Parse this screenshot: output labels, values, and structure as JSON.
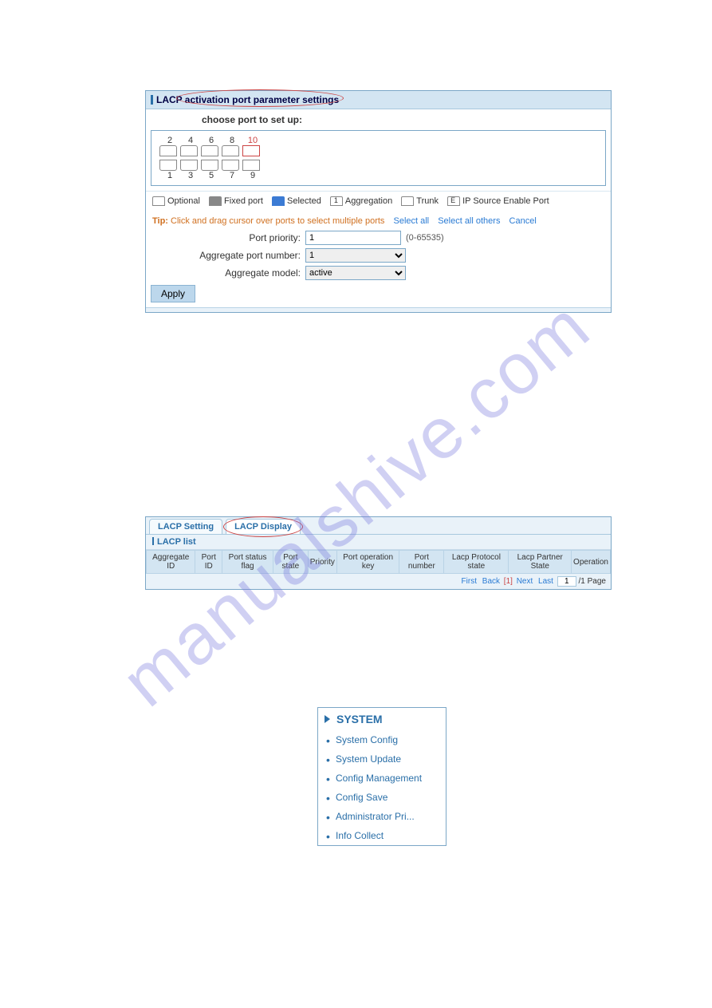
{
  "watermark": "manualshive.com",
  "panel1": {
    "title": "LACP activation port parameter settings",
    "choose_label": "choose port to set up:",
    "ports_top_nums": [
      "2",
      "4",
      "6",
      "8",
      "10"
    ],
    "ports_bottom_nums": [
      "1",
      "3",
      "5",
      "7",
      "9"
    ],
    "selected_port": "10",
    "legend": {
      "optional": "Optional",
      "fixed": "Fixed port",
      "selected": "Selected",
      "aggregation": "Aggregation",
      "trunk": "Trunk",
      "ipsrc": "IP Source Enable Port"
    },
    "tip_label": "Tip:",
    "tip_text": "Click and drag cursor over ports to select multiple ports",
    "link_select_all": "Select all",
    "link_select_others": "Select all others",
    "link_cancel": "Cancel",
    "form": {
      "port_priority_label": "Port priority:",
      "port_priority_value": "1",
      "port_priority_hint": "(0-65535)",
      "agg_port_num_label": "Aggregate port number:",
      "agg_port_num_value": "1",
      "agg_model_label": "Aggregate model:",
      "agg_model_value": "active"
    },
    "apply_label": "Apply"
  },
  "panel2": {
    "tab_setting": "LACP Setting",
    "tab_display": "LACP Display",
    "list_title": "LACP list",
    "columns": [
      "Aggregate ID",
      "Port ID",
      "Port status flag",
      "Port state",
      "Priority",
      "Port operation key",
      "Port number",
      "Lacp Protocol state",
      "Lacp Partner State",
      "Operation"
    ],
    "pager": {
      "first": "First",
      "back": "Back",
      "current": "[1]",
      "next": "Next",
      "last": "Last",
      "page_suffix": "/1 Page",
      "input_value": "1"
    }
  },
  "panel3": {
    "header": "SYSTEM",
    "items": [
      "System Config",
      "System Update",
      "Config Management",
      "Config Save",
      "Administrator Pri...",
      "Info Collect"
    ]
  }
}
